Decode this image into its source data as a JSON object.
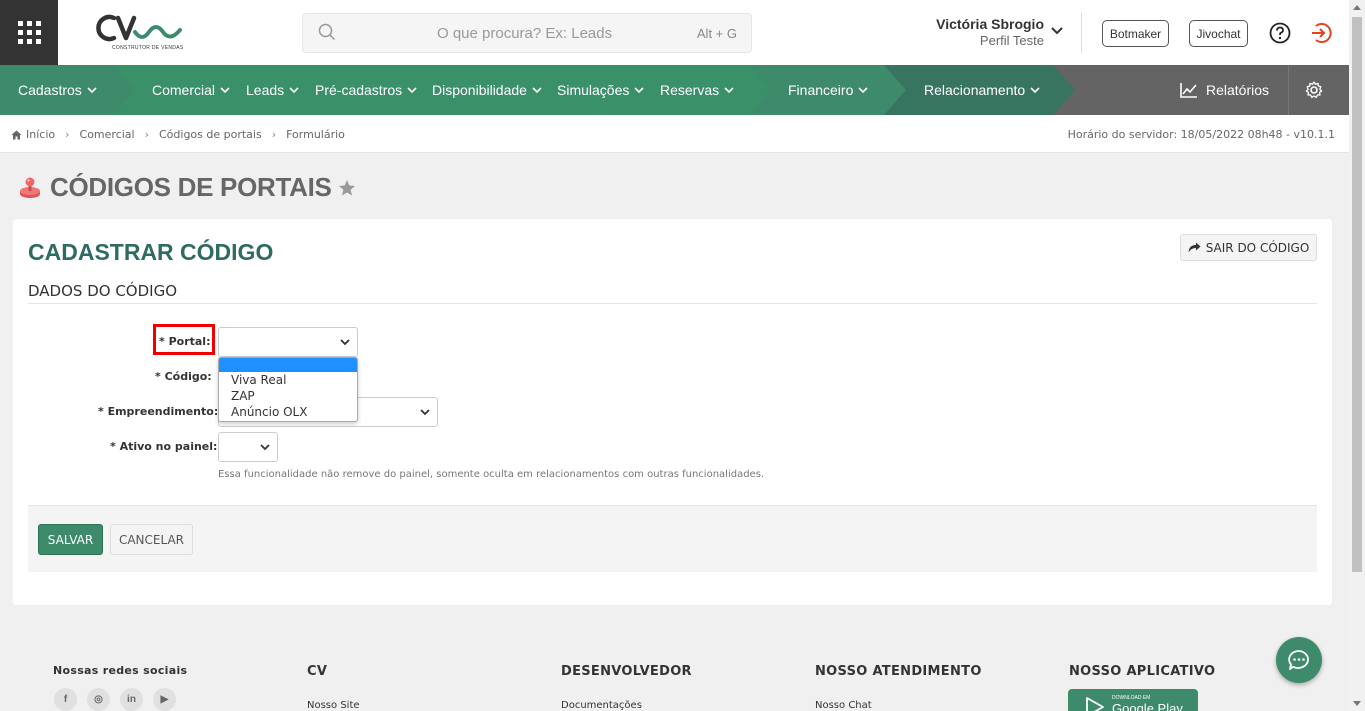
{
  "header": {
    "logo_text": "CV",
    "logo_subtitle": "CONSTRUTOR DE VENDAS",
    "search_placeholder": "O que procura? Ex: Leads",
    "search_shortcut": "Alt + G",
    "user_name": "Victória Sbrogio",
    "user_role": "Perfil Teste",
    "botmaker_label": "Botmaker",
    "jivochat_label": "Jivochat"
  },
  "nav": {
    "items": [
      {
        "label": "Cadastros"
      },
      {
        "label": "Comercial"
      },
      {
        "label": "Leads"
      },
      {
        "label": "Pré-cadastros"
      },
      {
        "label": "Disponibilidade"
      },
      {
        "label": "Simulações"
      },
      {
        "label": "Reservas"
      },
      {
        "label": "Financeiro"
      },
      {
        "label": "Relacionamento"
      }
    ],
    "reports_label": "Relatórios"
  },
  "breadcrumb": {
    "items": [
      "Início",
      "Comercial",
      "Códigos de portais",
      "Formulário"
    ],
    "server_info": "Horário do servidor: 18/05/2022 08h48 - v10.1.1"
  },
  "page": {
    "title": "CÓDIGOS DE PORTAIS"
  },
  "form": {
    "heading": "CADASTRAR CÓDIGO",
    "exit_button": "SAIR DO CÓDIGO",
    "section_title": "DADOS DO CÓDIGO",
    "fields": {
      "portal_label": "* Portal:",
      "codigo_label": "* Código:",
      "empreendimento_label": "* Empreendimento:",
      "ativo_label": "* Ativo no painel:"
    },
    "portal_options": [
      "",
      "Viva Real",
      "ZAP",
      "Anúncio OLX"
    ],
    "help_text": "Essa funcionalidade não remove do painel, somente oculta em relacionamentos com outras funcionalidades.",
    "save_label": "SALVAR",
    "cancel_label": "CANCELAR"
  },
  "footer": {
    "social_title": "Nossas redes sociais",
    "social_icons": [
      "f",
      "◎",
      "in",
      "▶"
    ],
    "cv_title": "CV",
    "cv_link": "Nosso Site",
    "dev_title": "DESENVOLVEDOR",
    "dev_link": "Documentações",
    "support_title": "NOSSO ATENDIMENTO",
    "support_link": "Nosso Chat",
    "app_title": "NOSSO APLICATIVO",
    "gplay_small": "DOWNLOAD EM",
    "gplay_big": "Google Play"
  },
  "colors": {
    "brand_green": "#3d8b6b",
    "heading_green": "#2e6b60",
    "highlight_red": "#e00000",
    "selected_blue": "#1e90ff"
  }
}
